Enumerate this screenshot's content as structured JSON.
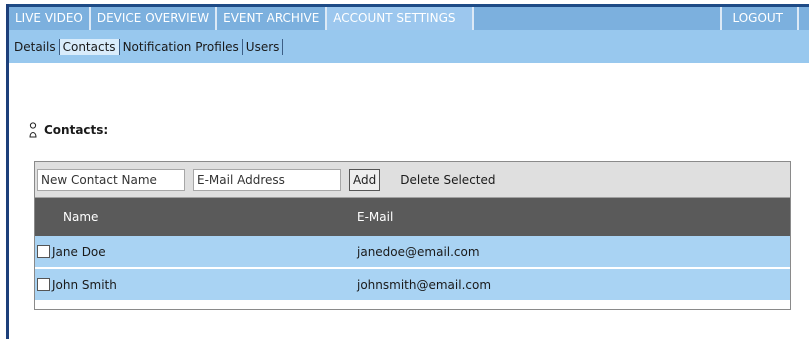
{
  "nav": {
    "items": [
      {
        "label": "LIVE VIDEO"
      },
      {
        "label": "DEVICE OVERVIEW"
      },
      {
        "label": "EVENT ARCHIVE"
      },
      {
        "label": "ACCOUNT SETTINGS",
        "active": true
      }
    ],
    "logout": "LOGOUT"
  },
  "subnav": {
    "items": [
      {
        "label": "Details"
      },
      {
        "label": "Contacts",
        "active": true
      },
      {
        "label": "Notification Profiles"
      },
      {
        "label": "Users"
      }
    ]
  },
  "section": {
    "title": "Contacts:",
    "icon": "contact-person-icon"
  },
  "toolbar": {
    "name_value": "New Contact Name",
    "email_value": "E-Mail Address",
    "add_label": "Add",
    "delete_label": "Delete Selected"
  },
  "table": {
    "columns": [
      "Name",
      "E-Mail"
    ],
    "rows": [
      {
        "name": "Jane Doe",
        "email": "janedoe@email.com",
        "checked": false
      },
      {
        "name": "John Smith",
        "email": "johnsmith@email.com",
        "checked": false
      }
    ]
  },
  "colors": {
    "nav_bg": "#7cb0de",
    "subnav_bg": "#98c8ee",
    "header_bg": "#5a5a5a",
    "row_bg": "#a9d3f3"
  }
}
